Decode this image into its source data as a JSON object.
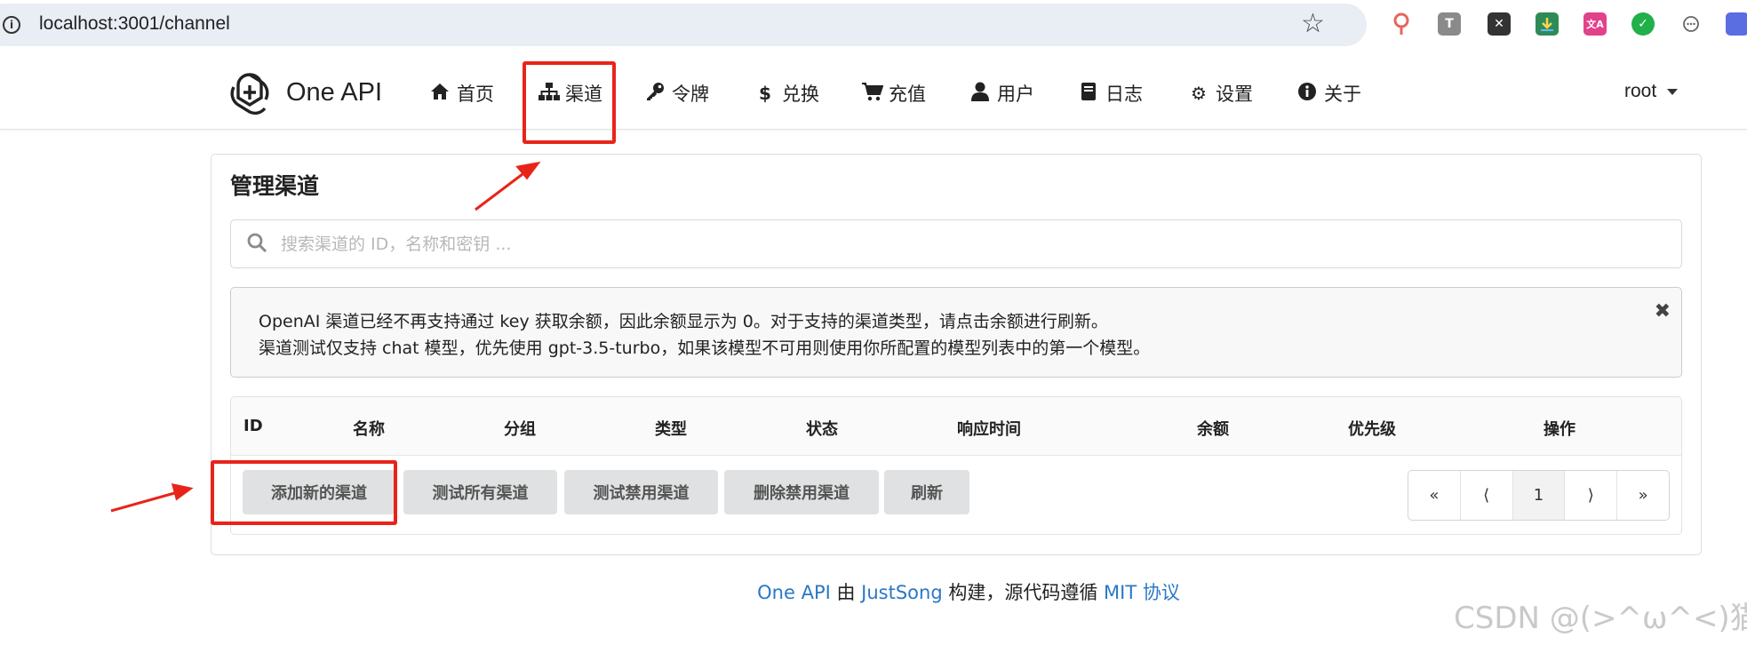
{
  "browser": {
    "url": "localhost:3001/channel",
    "extensions": [
      "ext-pin",
      "ext-t",
      "ext-x",
      "ext-download",
      "ext-translate",
      "ext-v",
      "ext-chat",
      "ext-puzzle"
    ],
    "ext_t_label": "T",
    "ext_x_label": "✕",
    "ext_translate_label": "文A",
    "ext_v_label": "✓"
  },
  "nav": {
    "brand": "One API",
    "items": [
      {
        "icon": "home-icon",
        "label": "首页"
      },
      {
        "icon": "sitemap-icon",
        "label": "渠道"
      },
      {
        "icon": "key-icon",
        "label": "令牌"
      },
      {
        "icon": "dollar-icon",
        "label": "兑换"
      },
      {
        "icon": "cart-icon",
        "label": "充值"
      },
      {
        "icon": "user-icon",
        "label": "用户"
      },
      {
        "icon": "book-icon",
        "label": "日志"
      },
      {
        "icon": "gear-icon",
        "label": "设置"
      },
      {
        "icon": "info-icon",
        "label": "关于"
      }
    ],
    "user": "root"
  },
  "main": {
    "title": "管理渠道",
    "search": {
      "placeholder": "搜索渠道的 ID，名称和密钥 ...",
      "value": ""
    },
    "notice": {
      "line1": "OpenAI 渠道已经不再支持通过 key 获取余额，因此余额显示为 0。对于支持的渠道类型，请点击余额进行刷新。",
      "line2": "渠道测试仅支持 chat 模型，优先使用 gpt-3.5-turbo，如果该模型不可用则使用你所配置的模型列表中的第一个模型。"
    },
    "table": {
      "columns": [
        "ID",
        "名称",
        "分组",
        "类型",
        "状态",
        "响应时间",
        "余额",
        "优先级",
        "操作"
      ],
      "rows": []
    },
    "buttons": {
      "add": "添加新的渠道",
      "test_all": "测试所有渠道",
      "test_disabled": "测试禁用渠道",
      "delete_disabled": "删除禁用渠道",
      "refresh": "刷新"
    },
    "pagination": {
      "first": "«",
      "prev": "⟨",
      "current": "1",
      "next": "⟩",
      "last": "»"
    }
  },
  "footer": {
    "brand_link": "One API",
    "by": " 由 ",
    "author_link": "JustSong",
    "text": " 构建，源代码遵循 ",
    "license_link": "MIT 协议"
  },
  "watermark": "CSDN @(>^ω^<)猫",
  "colors": {
    "link": "#2a78c6",
    "annotation": "#e8241a",
    "button_bg": "#e0e1e2"
  }
}
